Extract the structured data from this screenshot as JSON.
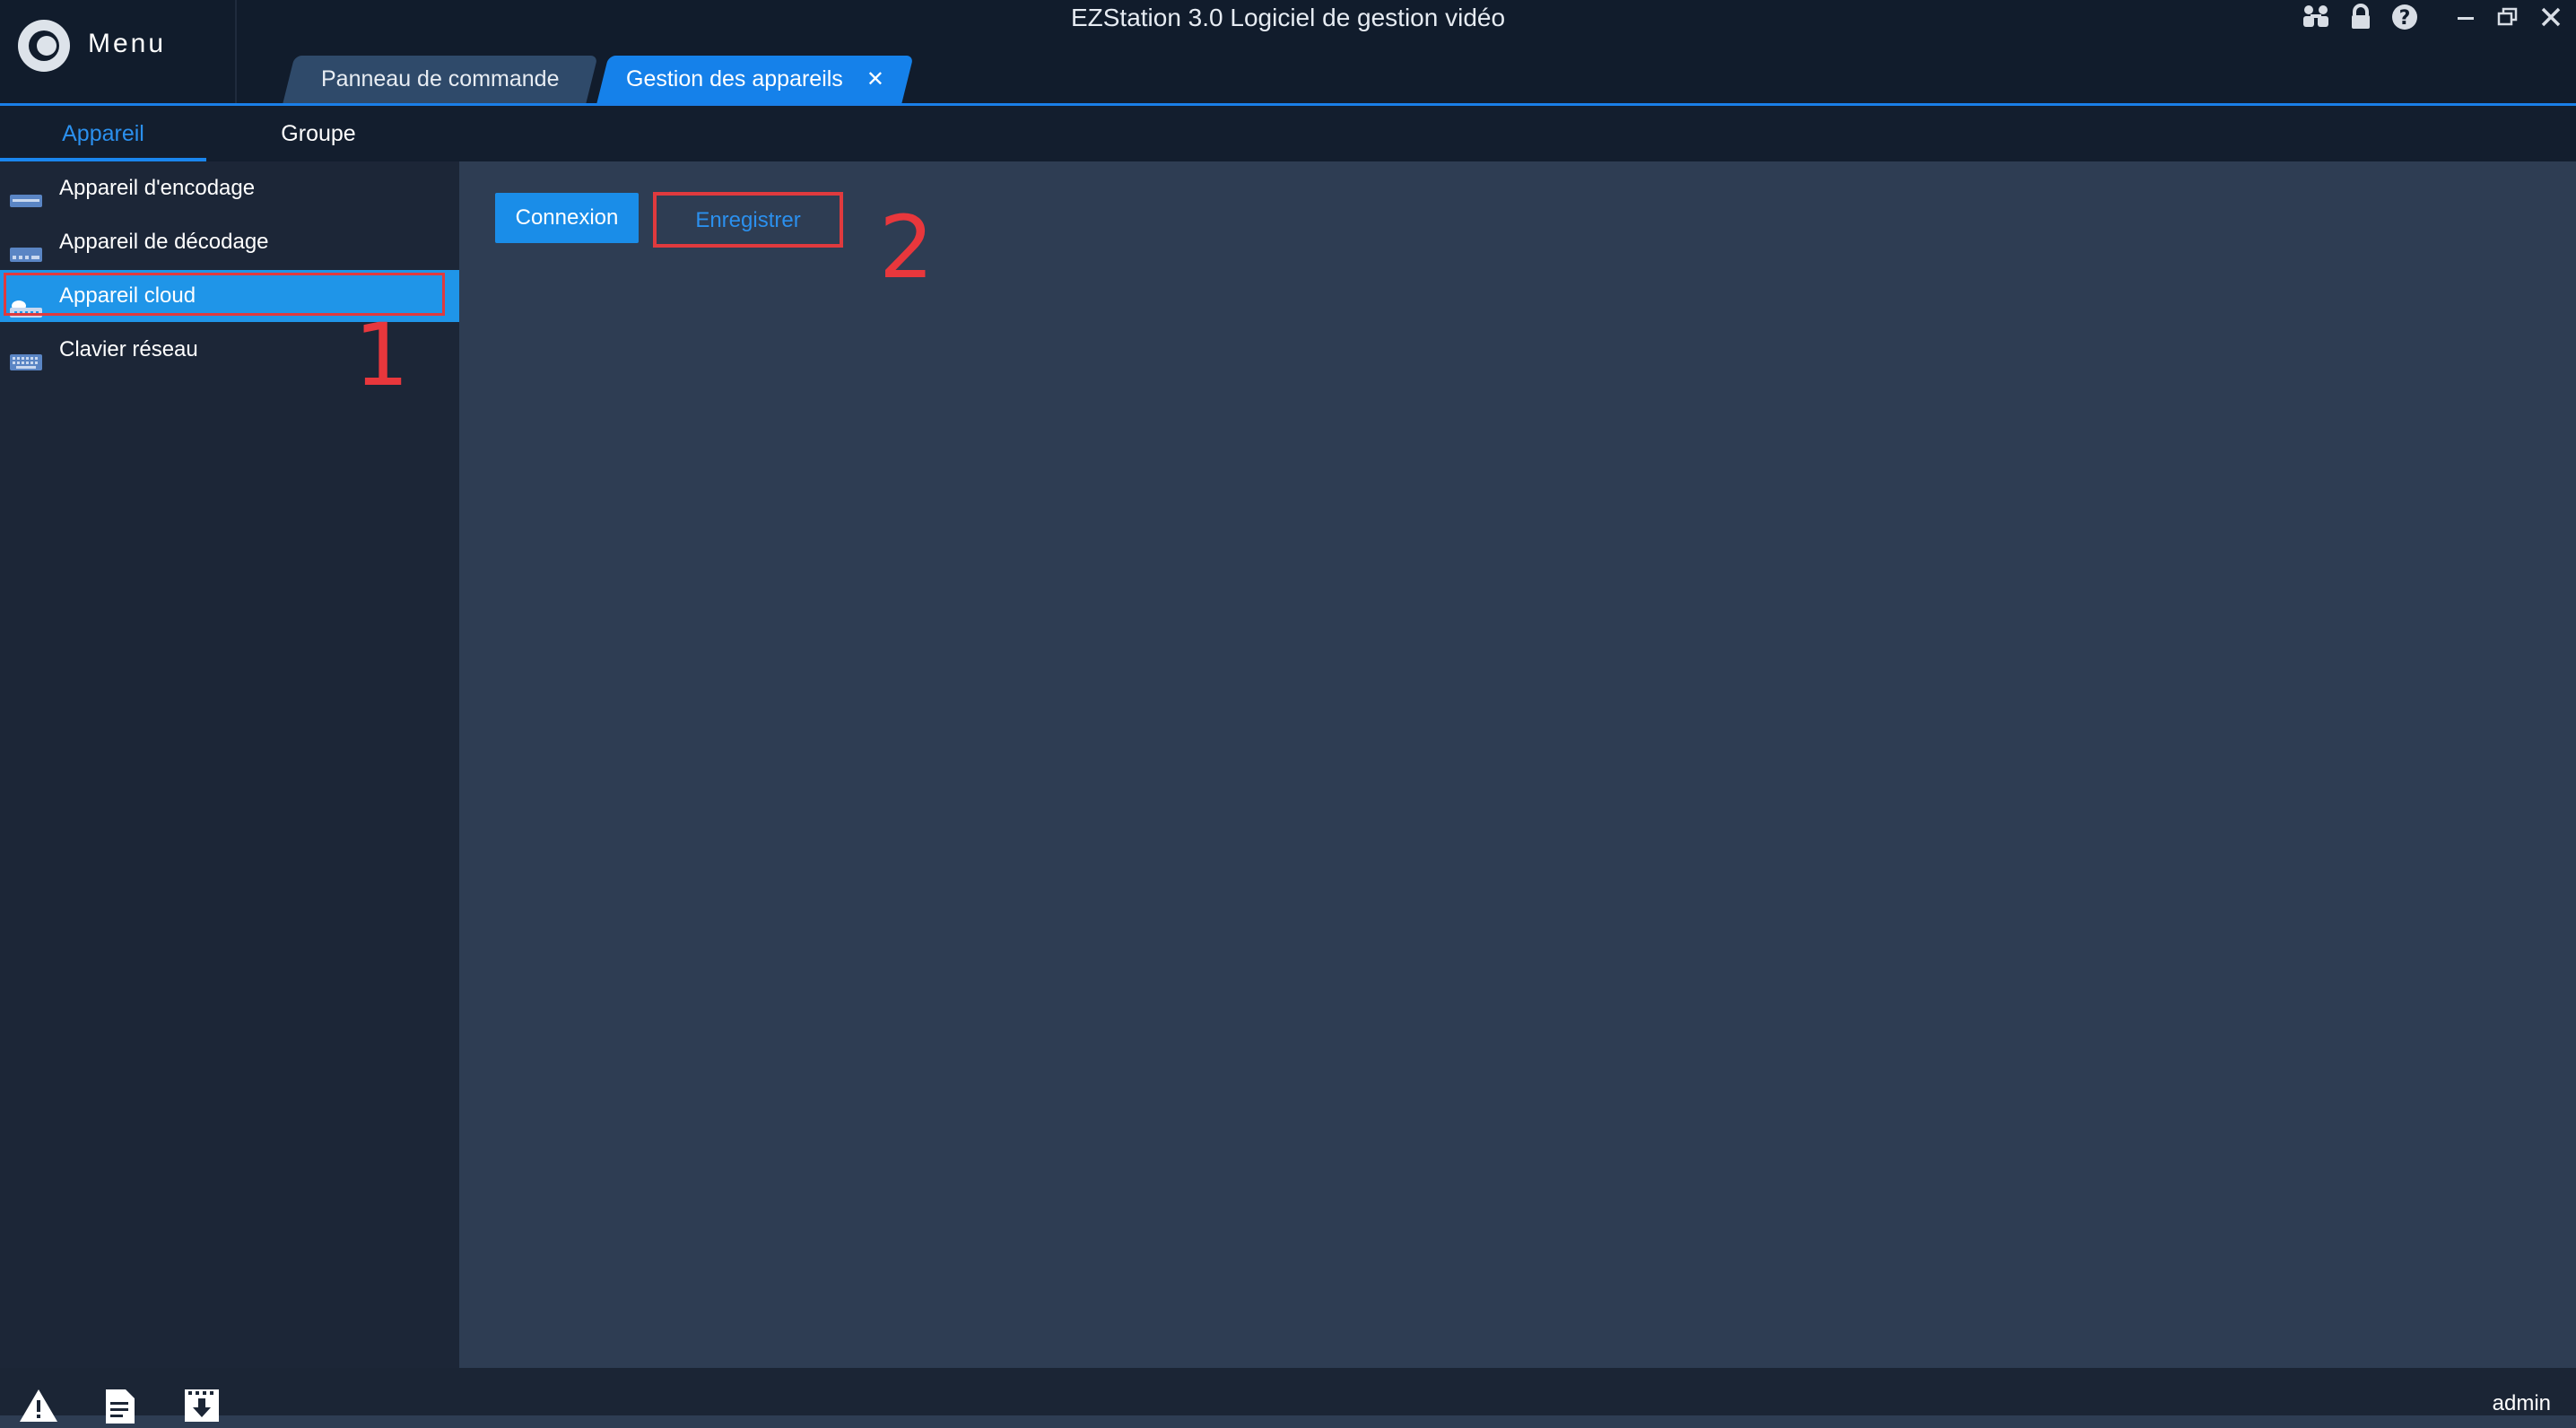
{
  "app": {
    "title": "EZStation 3.0 Logiciel de gestion vidéo",
    "menu_label": "Menu"
  },
  "tabs": [
    {
      "label": "Panneau de commande",
      "active": false
    },
    {
      "label": "Gestion des appareils",
      "active": true,
      "close_glyph": "✕"
    }
  ],
  "subtabs": [
    {
      "label": "Appareil",
      "active": true
    },
    {
      "label": "Groupe",
      "active": false
    }
  ],
  "sidebar": {
    "items": [
      {
        "label": "Appareil d'encodage",
        "icon": "encoder-device-icon"
      },
      {
        "label": "Appareil de décodage",
        "icon": "decoder-device-icon"
      },
      {
        "label": "Appareil cloud",
        "icon": "cloud-device-icon",
        "active": true
      },
      {
        "label": "Clavier réseau",
        "icon": "keyboard-icon"
      }
    ]
  },
  "main": {
    "connexion_label": "Connexion",
    "enregistrer_label": "Enregistrer"
  },
  "annotations": {
    "step1": "1",
    "step2": "2"
  },
  "status": {
    "user": "admin"
  },
  "colors": {
    "accent": "#1a8de8",
    "annotation": "#e03a3e",
    "background": "#2e3d53",
    "sidebar": "#1c2637"
  }
}
